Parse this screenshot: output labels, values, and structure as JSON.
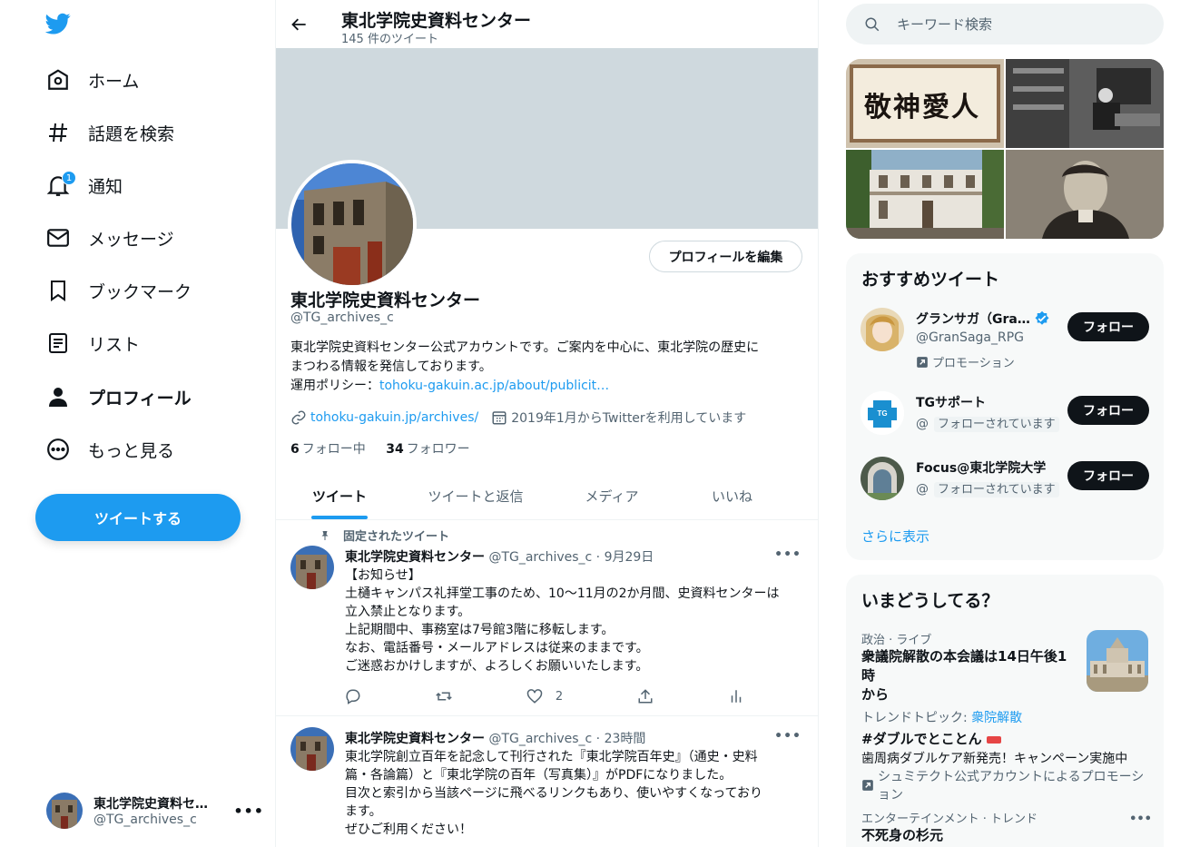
{
  "nav": {
    "items": [
      {
        "label": "ホーム",
        "icon": "home-icon"
      },
      {
        "label": "話題を検索",
        "icon": "hashtag-icon"
      },
      {
        "label": "通知",
        "icon": "bell-icon",
        "badge": "1"
      },
      {
        "label": "メッセージ",
        "icon": "envelope-icon"
      },
      {
        "label": "ブックマーク",
        "icon": "bookmark-icon"
      },
      {
        "label": "リスト",
        "icon": "list-icon"
      },
      {
        "label": "プロフィール",
        "icon": "person-icon"
      },
      {
        "label": "もっと見る",
        "icon": "more-circle-icon"
      }
    ],
    "tweet_button": "ツイートする",
    "account": {
      "name": "東北学院史資料セ…",
      "handle": "@TG_archives_c",
      "menu": "•••"
    }
  },
  "header": {
    "title": "東北学院史資料センター",
    "subtitle": "145 件のツイート"
  },
  "profile": {
    "edit_button": "プロフィールを編集",
    "name": "東北学院史資料センター",
    "handle": "@TG_archives_c",
    "bio_line1": "東北学院史資料センター公式アカウントです。ご案内を中心に、東北学院の歴史に",
    "bio_line2": "まつわる情報を発信しております。",
    "bio_policy_prefix": "運用ポリシー：",
    "bio_policy_link": "tohoku-gakuin.ac.jp/about/publicit…",
    "website": "tohoku-gakuin.jp/archives/",
    "joined": "2019年1月からTwitterを利用しています",
    "following_count": "6",
    "following_label": "フォロー中",
    "followers_count": "34",
    "followers_label": "フォロワー"
  },
  "tabs": [
    "ツイート",
    "ツイートと返信",
    "メディア",
    "いいね"
  ],
  "tweets": [
    {
      "pinned_label": "固定されたツイート",
      "name": "東北学院史資料センター",
      "meta": "@TG_archives_c · 9月29日",
      "lines": [
        "【お知らせ】",
        "土樋キャンパス礼拝堂工事のため、10～11月の2か月間、史資料センターは",
        "立入禁止となります。",
        "上記期間中、事務室は7号館3階に移転します。",
        "なお、電話番号・メールアドレスは従来のままです。",
        "ご迷惑おかけしますが、よろしくお願いいたします。"
      ],
      "likes": "2"
    },
    {
      "name": "東北学院史資料センター",
      "meta": "@TG_archives_c · 23時間",
      "lines": [
        "東北学院創立百年を記念して刊行された『東北学院百年史』（通史・史料",
        "篇・各論篇）と『東北学院の百年（写真集）』がPDFになりました。",
        "目次と索引から当該ページに飛べるリンクもあり、使いやすくなっており",
        "ます。",
        "ぜひご利用ください！"
      ]
    }
  ],
  "search": {
    "placeholder": "キーワード検索"
  },
  "media_tiles": [
    "敬神愛人"
  ],
  "recommend": {
    "title": "おすすめツイート",
    "users": [
      {
        "name": "グランサガ（Gra…",
        "handle": "@GranSaga_RPG",
        "promo": "プロモーション",
        "button": "フォロー",
        "verified": true
      },
      {
        "name": "TGサポート",
        "handle": "@",
        "follows_you": "フォローされています",
        "button": "フォロー",
        "avatar_text": "TG SUPPORT"
      },
      {
        "name": "Focus@東北学院大学",
        "handle": "@",
        "follows_you": "フォローされています",
        "button": "フォロー"
      }
    ],
    "more": "さらに表示"
  },
  "trends": {
    "title": "いまどうしてる？",
    "items": [
      {
        "category": "政治 · ライブ",
        "title_line1": "衆議院解散の本会議は14日午後1時",
        "title_line2": "から",
        "sub_prefix": "トレンドトピック: ",
        "sub_link": "衆院解散"
      },
      {
        "title": "#ダブルでとことん",
        "line": "歯周病ダブルケア新発売！キャンペーン実施中",
        "promo": "シュミテクト公式アカウントによるプロモーション"
      },
      {
        "category": "エンターテインメント · トレンド",
        "title": "不死身の杉元",
        "menu": "•••"
      }
    ]
  },
  "colors": {
    "accent": "#1d9bf0",
    "text": "#0f1419",
    "muted": "#536471",
    "panel": "#f7f9f9",
    "banner": "#cfd9de"
  }
}
